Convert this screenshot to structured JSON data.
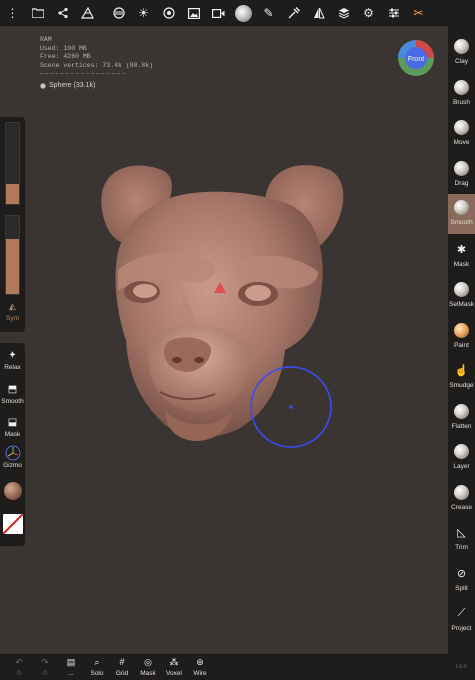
{
  "topbar": {
    "icons": [
      "folder-icon",
      "scene-graph-icon",
      "topology-icon",
      "postprocess-icon",
      "light-icon",
      "material-icon",
      "image-icon",
      "video-icon",
      "matcap-icon",
      "paint-icon",
      "picker-icon",
      "mirror-icon",
      "layers-icon",
      "settings-icon",
      "sliders-icon",
      "tools-icon"
    ]
  },
  "stats": {
    "ram": "RAM",
    "used": "Used: 100 MB",
    "free": "Free: 4260 MB",
    "vertices": "Scene vertices: 73.4k (80.8k)"
  },
  "mesh": {
    "label": "Sphere (33.1k)"
  },
  "gizmo": {
    "label": "Front"
  },
  "right_tools": [
    {
      "label": "Clay",
      "icon": "clay-icon"
    },
    {
      "label": "Brush",
      "icon": "brush-icon"
    },
    {
      "label": "Move",
      "icon": "move-icon"
    },
    {
      "label": "Drag",
      "icon": "drag-icon"
    },
    {
      "label": "Smooth",
      "icon": "smooth-icon"
    },
    {
      "label": "Mask",
      "icon": "mask-icon"
    },
    {
      "label": "SelMask",
      "icon": "selmask-icon"
    },
    {
      "label": "Paint",
      "icon": "paint-icon"
    },
    {
      "label": "Smudge",
      "icon": "smudge-icon"
    },
    {
      "label": "Flatten",
      "icon": "flatten-icon"
    },
    {
      "label": "Layer",
      "icon": "layer-icon"
    },
    {
      "label": "Crease",
      "icon": "crease-icon"
    },
    {
      "label": "Trim",
      "icon": "trim-icon"
    },
    {
      "label": "Split",
      "icon": "split-icon"
    },
    {
      "label": "Project",
      "icon": "project-icon"
    }
  ],
  "left_panel": {
    "radius_level": 0.25,
    "intensity_level": 0.7,
    "sym_label": "Sym"
  },
  "left_tools": [
    {
      "label": "Relax",
      "icon": "relax-icon"
    },
    {
      "label": "Smooth",
      "icon": "smooth-toggle-icon"
    },
    {
      "label": "Mask",
      "icon": "mask-toggle-icon"
    },
    {
      "label": "Gizmo",
      "icon": "gizmo-icon"
    }
  ],
  "bottom_tools": [
    {
      "label": "0",
      "icon": "undo-icon",
      "dim": true
    },
    {
      "label": "0",
      "icon": "redo-icon",
      "dim": true
    },
    {
      "label": "...",
      "icon": "menu-icon",
      "dim": false
    },
    {
      "label": "Solo",
      "icon": "solo-icon",
      "dim": false
    },
    {
      "label": "Grid",
      "icon": "grid-icon",
      "dim": false
    },
    {
      "label": "Mask",
      "icon": "mask-visibility-icon",
      "dim": false
    },
    {
      "label": "Voxel",
      "icon": "voxel-icon",
      "dim": false
    },
    {
      "label": "Wire",
      "icon": "wire-icon",
      "dim": false
    }
  ],
  "version": "1.6.4",
  "colors": {
    "accent": "#8a6a5a",
    "material": "#b07a5a",
    "cursor": "#3b4cf0"
  }
}
